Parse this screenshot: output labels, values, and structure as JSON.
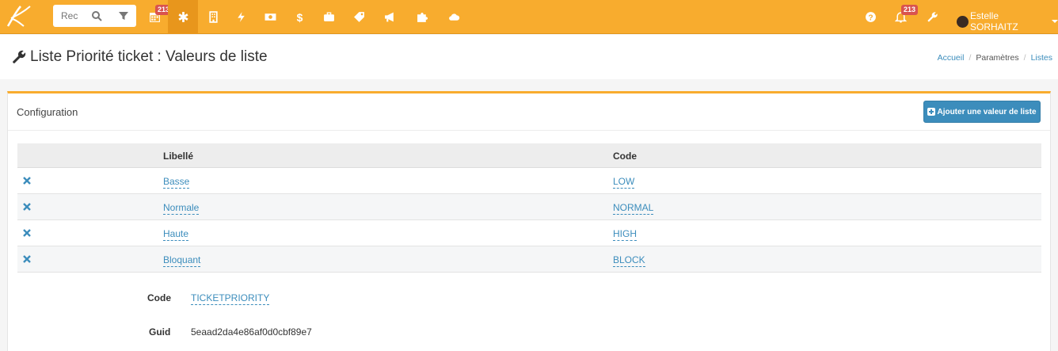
{
  "topbar": {
    "search_placeholder": "Rec",
    "calendar_badge": "213",
    "notifications_badge": "213",
    "user_name": "Estelle SORHAITZ",
    "nav_icons": [
      "calendar-icon",
      "asterisk-icon",
      "building-icon",
      "bolt-icon",
      "money-icon",
      "dollar-icon",
      "briefcase-icon",
      "tag-icon",
      "bullhorn-icon",
      "puzzle-icon",
      "cloud-icon"
    ],
    "colors": {
      "bar": "#f8ac2e",
      "active": "#e8961c",
      "badge": "#d9534f"
    }
  },
  "page": {
    "title": "Liste Priorité ticket : Valeurs de liste",
    "breadcrumb": [
      "Accueil",
      "Paramètres",
      "Listes"
    ]
  },
  "box": {
    "title": "Configuration",
    "add_button": "Ajouter une valeur de liste",
    "columns": {
      "label": "Libellé",
      "code": "Code"
    },
    "rows": [
      {
        "label": "Basse",
        "code": "LOW"
      },
      {
        "label": "Normale",
        "code": "NORMAL"
      },
      {
        "label": "Haute",
        "code": "HIGH"
      },
      {
        "label": "Bloquant",
        "code": "BLOCK"
      }
    ],
    "properties": {
      "code_label": "Code",
      "code_value": "TICKETPRIORITY",
      "guid_label": "Guid",
      "guid_value": "5eaad2da4e86af0d0cbf89e7"
    }
  },
  "accent_color": "#3c8dbc"
}
